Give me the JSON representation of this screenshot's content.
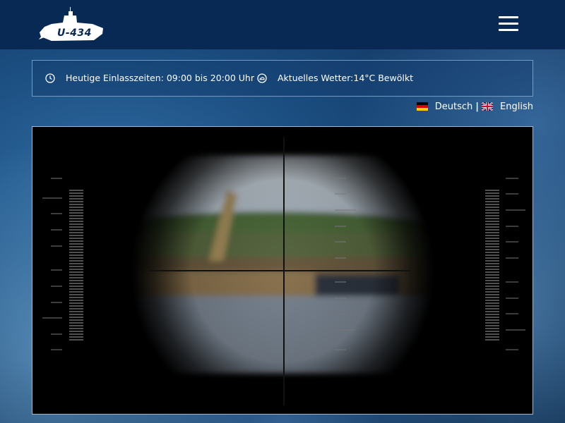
{
  "header": {
    "logo_text": "U-434",
    "menu_icon": "hamburger-menu-icon"
  },
  "infobar": {
    "hours": "Heutige Einlasszeiten: 09:00 bis 20:00 Uhr",
    "weather": "Aktuelles Wetter:14°C Bewölkt",
    "hours_icon": "clock-icon",
    "weather_icon": "cloud-icon"
  },
  "languages": {
    "german": "Deutsch",
    "separator": "|",
    "english": "English"
  },
  "colors": {
    "header_bg": "#082954",
    "accent": "#ffffff"
  }
}
